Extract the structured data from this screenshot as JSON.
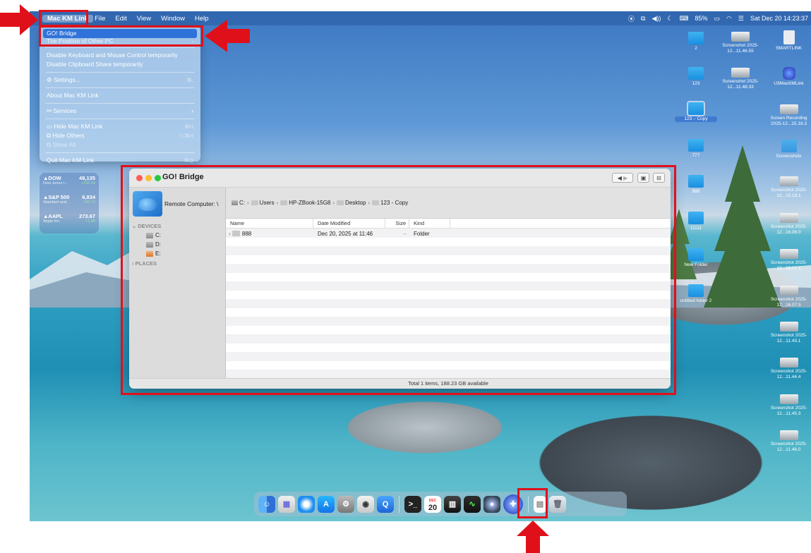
{
  "menubar": {
    "apple": "",
    "items": [
      "Mac KM Link",
      "File",
      "Edit",
      "View",
      "Window",
      "Help"
    ],
    "datetime": "Sat Dec 20  14:23:37",
    "battery": "85%"
  },
  "menu": {
    "items": [
      {
        "label": "GO! Bridge",
        "shortcut": ""
      },
      {
        "label": "The Position of Other PC",
        "shortcut": ""
      },
      {
        "label": "Disable Keyboard and Mouse Control temporarily",
        "shortcut": ""
      },
      {
        "label": "Disable Clipboard Share temporarily",
        "shortcut": ""
      },
      {
        "label": "Settings...",
        "shortcut": "⌘,"
      },
      {
        "label": "About Mac KM Link",
        "shortcut": ""
      },
      {
        "label": "Services",
        "shortcut": "›"
      },
      {
        "label": "Hide Mac KM Link",
        "shortcut": "⌘H"
      },
      {
        "label": "Hide Others",
        "shortcut": "⌥⌘H"
      },
      {
        "label": "Show All",
        "shortcut": ""
      },
      {
        "label": "Quit Mac KM Link",
        "shortcut": "⌘Q"
      }
    ]
  },
  "stocks": [
    {
      "symbol": "▲DOW",
      "value": "48,135",
      "name": "Dow Jones I...",
      "change": "+183.04"
    },
    {
      "symbol": "▲S&P 500",
      "value": "6,834",
      "name": "Standard and...",
      "change": "+59.74"
    },
    {
      "symbol": "▲AAPL",
      "value": "273.67",
      "name": "Apple Inc.",
      "change": "+1.48"
    }
  ],
  "window": {
    "title": "GO! Bridge",
    "remote_label": "Remote Computer: \\",
    "devices_header": "DEVICES",
    "places_header": "PLACES",
    "drives": [
      "C:",
      "D:",
      "E:"
    ],
    "path": [
      "C:",
      "Users",
      "HP-ZBook-15G8",
      "Desktop",
      "123 - Copy"
    ],
    "columns": {
      "name": "Name",
      "date": "Date Modified",
      "size": "Size",
      "kind": "Kind"
    },
    "rows": [
      {
        "name": "888",
        "date": "Dec 20, 2025 at 11:46",
        "size": "--",
        "kind": "Folder"
      }
    ],
    "status": "Total 1 items, 188.23 GB available"
  },
  "desktop_icons": [
    {
      "label": "2",
      "type": "folder"
    },
    {
      "label": "123",
      "type": "folder"
    },
    {
      "label": "123 – Copy",
      "type": "folder"
    },
    {
      "label": "777",
      "type": "folder"
    },
    {
      "label": "888",
      "type": "folder"
    },
    {
      "label": "11111",
      "type": "folder"
    },
    {
      "label": "New Folder",
      "type": "folder"
    },
    {
      "label": "untitled folder 2",
      "type": "folder"
    },
    {
      "label": "Screenshot 2025-12...11.46.55",
      "type": "shot"
    },
    {
      "label": "Screenshot 2025-12...11.48.33",
      "type": "shot"
    },
    {
      "label": "SMARTLINK",
      "type": "doc"
    },
    {
      "label": "U3MacKMLink",
      "type": "app"
    },
    {
      "label": "Screen Recording 2025-12...15.18.3",
      "type": "shot"
    },
    {
      "label": "Screenshots",
      "type": "folder"
    },
    {
      "label": "Screenshot 2025-12...15.19.1",
      "type": "shot"
    },
    {
      "label": "Screenshot 2025-12...16.06.0",
      "type": "shot"
    },
    {
      "label": "Screenshot 2025-12...16.07.1",
      "type": "shot"
    },
    {
      "label": "Screenshot 2025-12...16.07.5",
      "type": "shot"
    },
    {
      "label": "Screenshot 2025-12...11.43.1",
      "type": "shot"
    },
    {
      "label": "Screenshot 2025-12...11.44.4",
      "type": "shot"
    },
    {
      "label": "Screenshot 2025-12...11.45.3",
      "type": "shot"
    },
    {
      "label": "Screenshot 2025-12...11.46.0",
      "type": "shot"
    }
  ],
  "dock": {
    "calendar_month": "DEC",
    "calendar_day": "20",
    "apps": [
      "Finder",
      "Launchpad",
      "Safari",
      "App Store",
      "System Settings",
      "Screenshot",
      "QuickTime",
      "Terminal",
      "Calendar",
      "Piano",
      "Activity Monitor",
      "Disk",
      "Mac KM Link",
      "Documents",
      "Trash"
    ]
  },
  "colors": {
    "highlight_red": "#e0101a",
    "menu_highlight": "#2f72d9"
  }
}
